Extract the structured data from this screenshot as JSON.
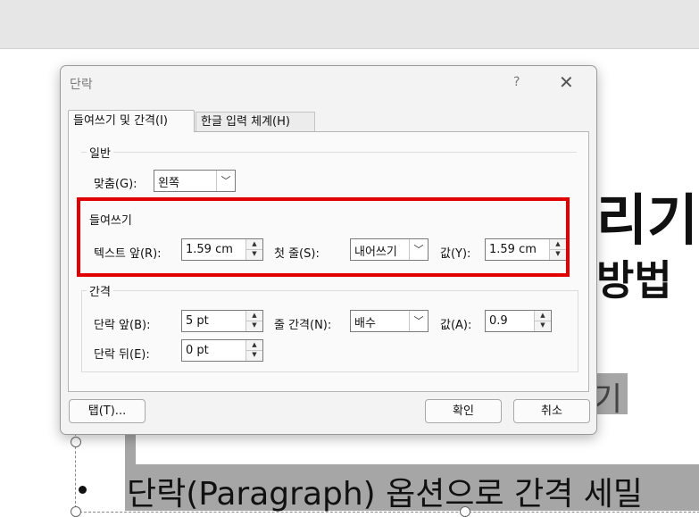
{
  "background": {
    "big_line_1": "리기",
    "big_line_2": "방법",
    "highlight_line_1": "기",
    "highlight_line_2": "단락(Paragraph) 옵션으로 간격 세밀"
  },
  "dialog": {
    "title": "단락",
    "help": "?",
    "close": "✕",
    "tabs": [
      "들여쓰기 및 간격(I)",
      "한글 입력 체계(H)"
    ],
    "general": {
      "label": "일반",
      "align_label": "맞춤(G):",
      "align_value": "왼쪽"
    },
    "indent": {
      "label": "들여쓰기",
      "before_text_label": "텍스트 앞(R):",
      "before_text_value": "1.59 cm",
      "first_line_label": "첫 줄(S):",
      "first_line_value": "내어쓰기",
      "by_label": "값(Y):",
      "by_value": "1.59 cm"
    },
    "spacing": {
      "label": "간격",
      "before_label": "단락 앞(B):",
      "before_value": "5 pt",
      "after_label": "단락 뒤(E):",
      "after_value": "0 pt",
      "line_spacing_label": "줄 간격(N):",
      "line_spacing_value": "배수",
      "at_label": "값(A):",
      "at_value": "0.9"
    },
    "buttons": {
      "tabs": "탭(T)...",
      "ok": "확인",
      "cancel": "취소"
    }
  },
  "annotation_color": "#e00000"
}
